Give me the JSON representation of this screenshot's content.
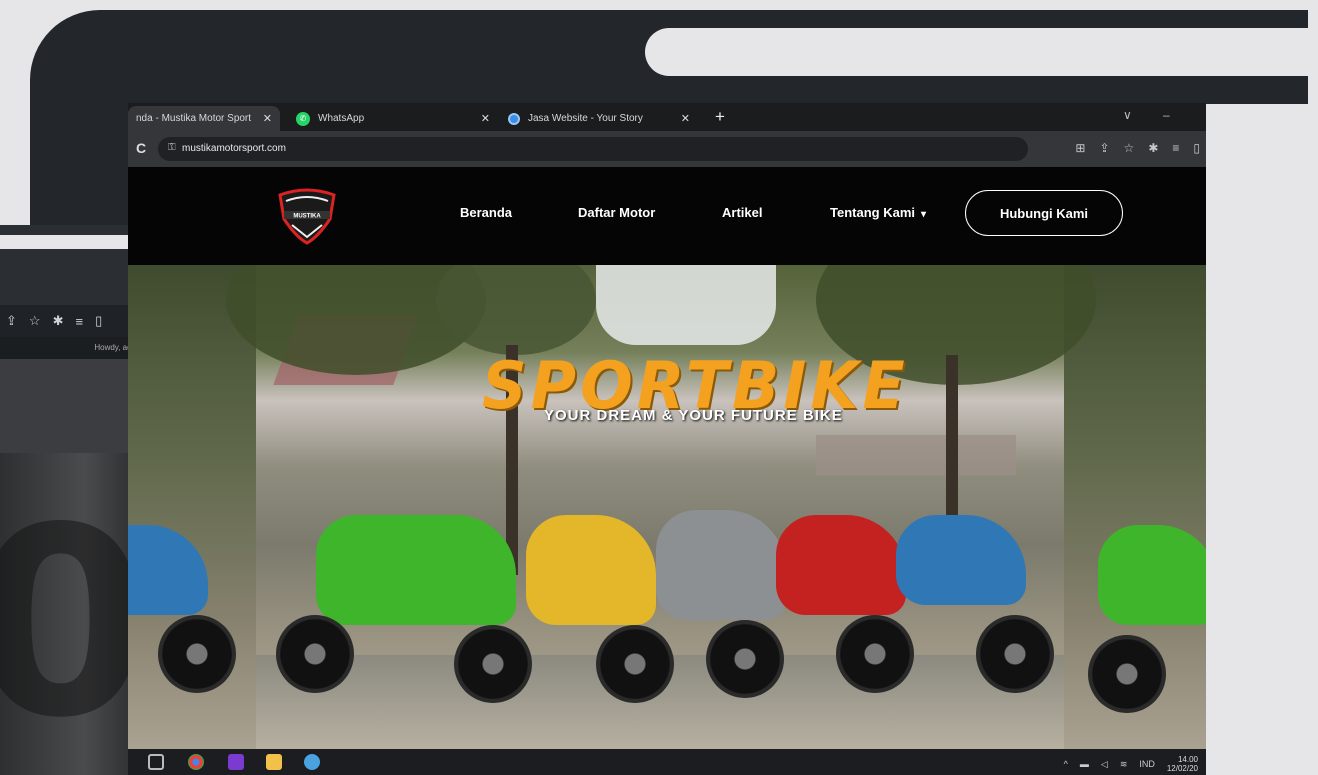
{
  "browser": {
    "tabs": [
      {
        "title": "nda - Mustika Motor Sport",
        "active": true
      },
      {
        "title": "WhatsApp",
        "active": false
      },
      {
        "title": "Jasa Website - Your Story",
        "active": false
      }
    ],
    "new_tab": "+",
    "url": "mustikamotorsport.com",
    "window_controls": {
      "minimize": "–",
      "dropdown": "∨"
    }
  },
  "site": {
    "logo_text": "MUSTIKA",
    "nav": {
      "beranda": "Beranda",
      "daftar_motor": "Daftar Motor",
      "artikel": "Artikel",
      "tentang_kami": "Tentang Kami"
    },
    "cta": "Hubungi Kami",
    "hero": {
      "headline": "SPORTBIKE",
      "tagline": "YOUR DREAM & YOUR FUTURE BIKE"
    }
  },
  "background_window": {
    "admin_text": "Howdy, admi"
  },
  "taskbar": {
    "tray": {
      "language": "IND",
      "time": "14.00",
      "date": "12/02/20"
    }
  },
  "colors": {
    "headline": "#f3a11f",
    "nav_bg": "#050505",
    "frame": "#23272b",
    "page_bg": "#e6e5e8"
  },
  "icons": [
    "search-icon",
    "share-icon",
    "star-icon",
    "extensions-icon",
    "reading-list-icon",
    "sidepanel-icon",
    "lock-icon",
    "reload-icon"
  ]
}
